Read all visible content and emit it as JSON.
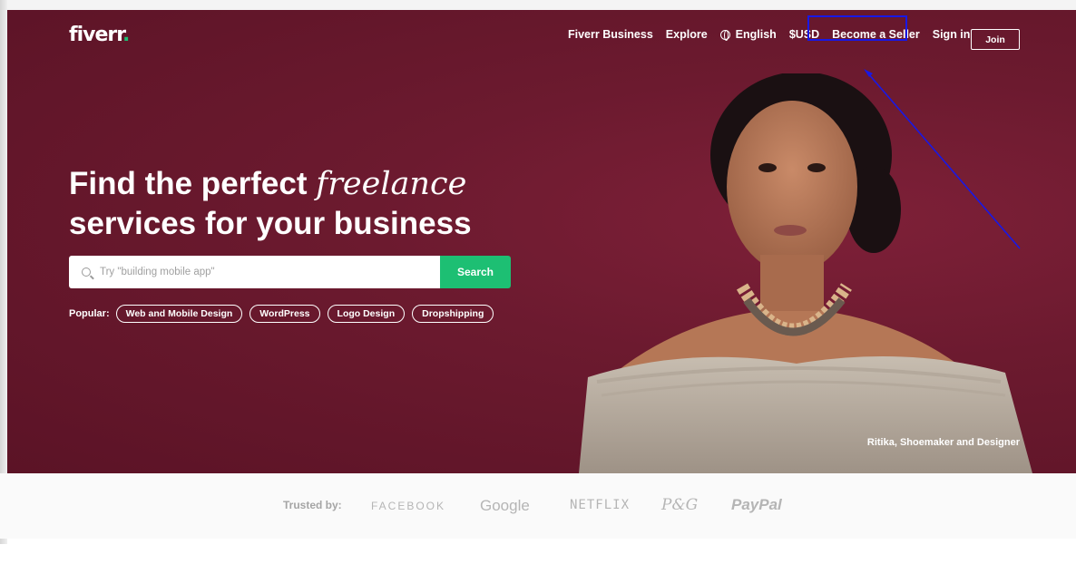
{
  "header": {
    "logo": "fiverr",
    "logo_dot": ".",
    "nav": {
      "business": "Fiverr Business",
      "explore": "Explore",
      "language": "English",
      "currency": "$USD",
      "become_seller": "Become a Seller",
      "sign_in": "Sign in",
      "join": "Join"
    }
  },
  "hero": {
    "headline_part1": "Find the perfect ",
    "headline_italic": "freelance",
    "headline_line2": "services for your business",
    "search": {
      "placeholder": "Try \"building mobile app\"",
      "button": "Search"
    },
    "popular_label": "Popular:",
    "popular_tags": [
      "Web and Mobile Design",
      "WordPress",
      "Logo Design",
      "Dropshipping"
    ],
    "caption": "Ritika, Shoemaker and Designer"
  },
  "trusted": {
    "label": "Trusted by:",
    "brands": [
      "FACEBOOK",
      "Google",
      "NETFLIX",
      "P&G",
      "PayPal"
    ]
  },
  "colors": {
    "hero_bg": "#6c1a2f",
    "brand_green": "#1dbf73",
    "highlight_box": "#1818e6"
  }
}
